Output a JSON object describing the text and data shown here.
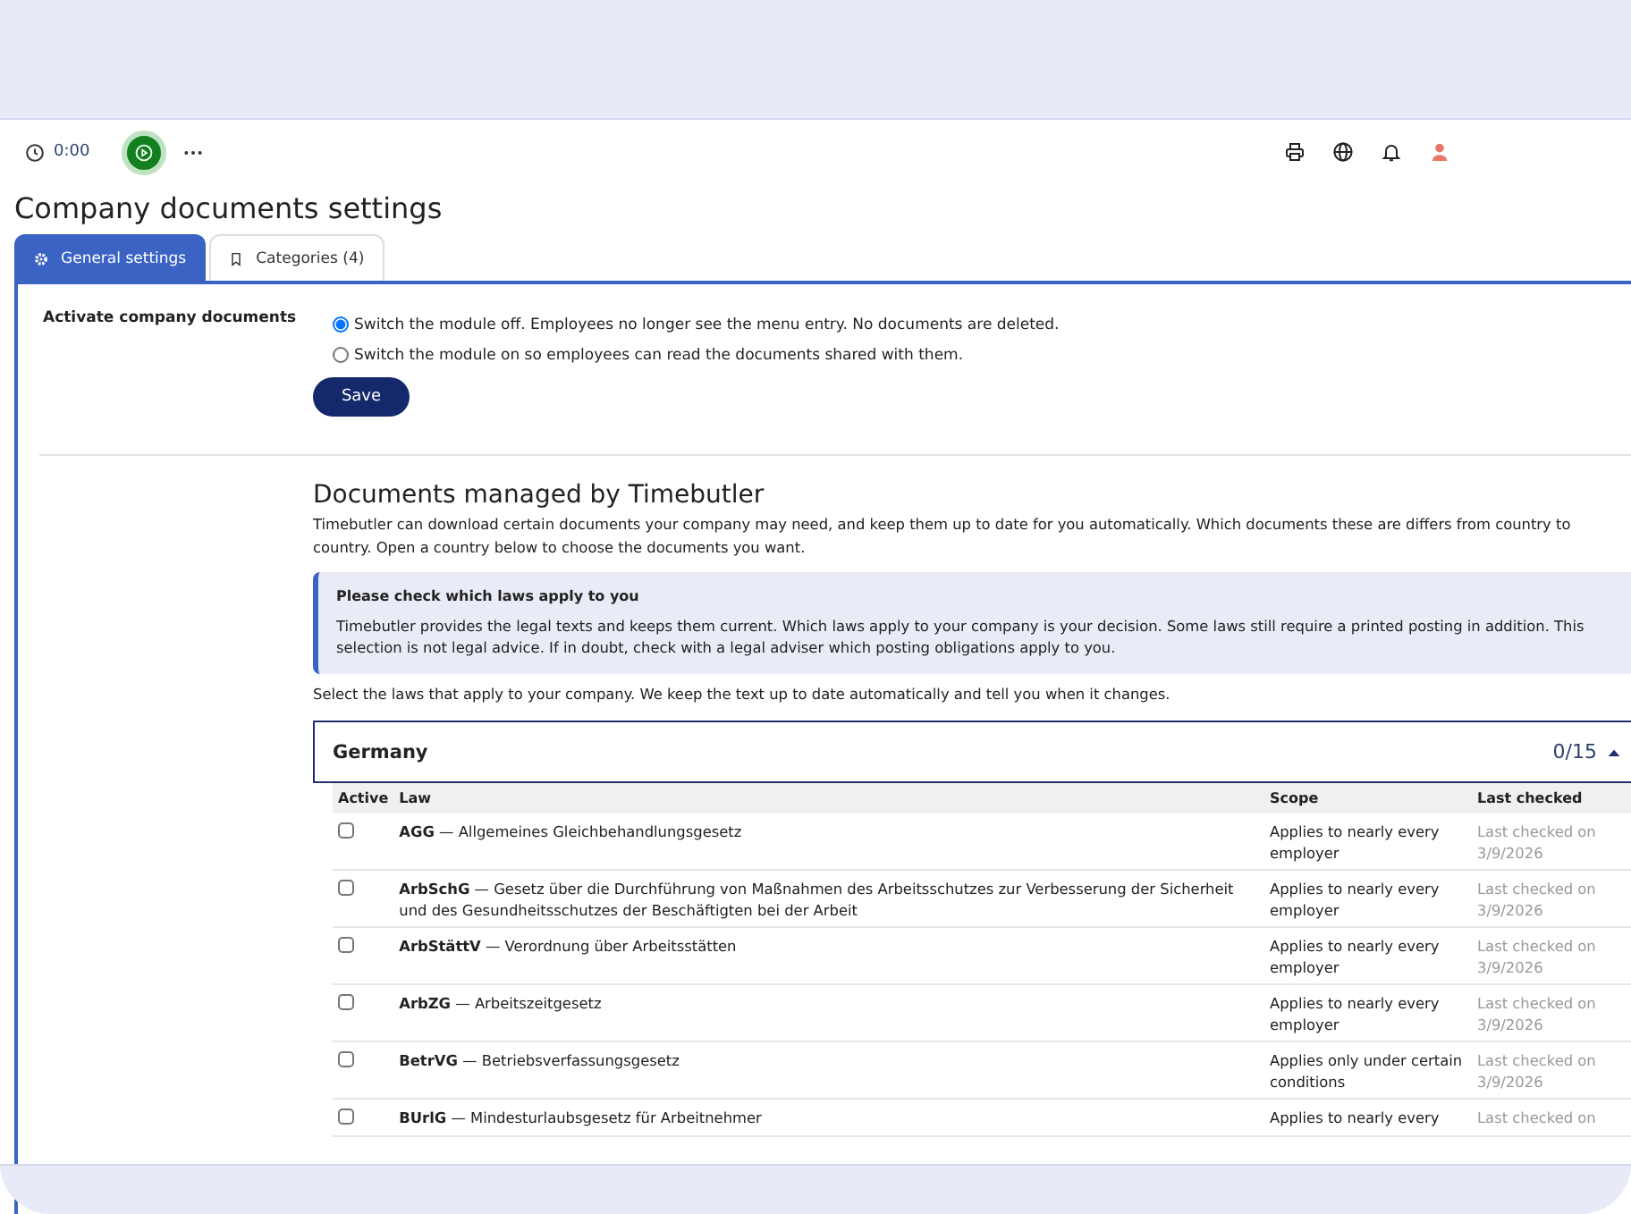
{
  "toolbar": {
    "time": "0:00"
  },
  "title": "Company documents settings",
  "tabs": [
    {
      "label": "General settings",
      "selected": true
    },
    {
      "label": "Categories (4)",
      "selected": false
    }
  ],
  "settings": {
    "label": "Activate company documents",
    "options": [
      {
        "label": "Switch the module off. Employees no longer see the menu entry. No documents are deleted.",
        "selected": true
      },
      {
        "label": "Switch the module on so employees can read the documents shared with them.",
        "selected": false
      }
    ],
    "save_button": "Save"
  },
  "managed": {
    "heading": "Documents managed by Timebutler",
    "intro": "Timebutler can download certain documents your company may need, and keep them up to date for you automatically. Which documents these are differs from country to country. Open a country below to choose the documents you want.",
    "notice": {
      "title": "Please check which laws apply to you",
      "text": "Timebutler provides the legal texts and keeps them current. Which laws apply to your company is your decision. Some laws still require a printed posting in addition. This selection is not legal advice. If in doubt, check with a legal adviser which posting obligations apply to you."
    },
    "instruction": "Select the laws that apply to your company. We keep the text up to date automatically and tell you when it changes.",
    "countries": [
      {
        "name": "Germany",
        "count": "0/15",
        "expanded": true,
        "columns": [
          "Active",
          "Law",
          "Scope",
          "Last checked"
        ],
        "rows": [
          {
            "checked": false,
            "law": "**AGG** — Allgemeines Gleichbehandlungsgesetz",
            "scope": "Applies to nearly every employer",
            "last_checked": "Last checked on 3/9/2026"
          },
          {
            "checked": false,
            "law": "**ArbSchG** — Gesetz über die Durchführung von Maßnahmen des Arbeitsschutzes zur Verbesserung der Sicherheit und des Gesundheitsschutzes der Beschäftigten bei der Arbeit",
            "scope": "Applies to nearly every employer",
            "last_checked": "Last checked on 3/9/2026"
          },
          {
            "checked": false,
            "law": "**ArbStättV** — Verordnung über Arbeitsstätten",
            "scope": "Applies to nearly every employer",
            "last_checked": "Last checked on 3/9/2026"
          },
          {
            "checked": false,
            "law": "**ArbZG** — Arbeitszeitgesetz",
            "scope": "Applies to nearly every employer",
            "last_checked": "Last checked on 3/9/2026"
          },
          {
            "checked": false,
            "law": "**BetrVG** — Betriebsverfassungsgesetz",
            "scope": "Applies only under certain conditions",
            "last_checked": "Last checked on 3/9/2026"
          },
          {
            "checked": false,
            "law": "**BUrlG** — Mindesturlaubsgesetz für Arbeitnehmer",
            "scope": "Applies to nearly every",
            "last_checked": "Last checked on"
          }
        ]
      }
    ]
  }
}
